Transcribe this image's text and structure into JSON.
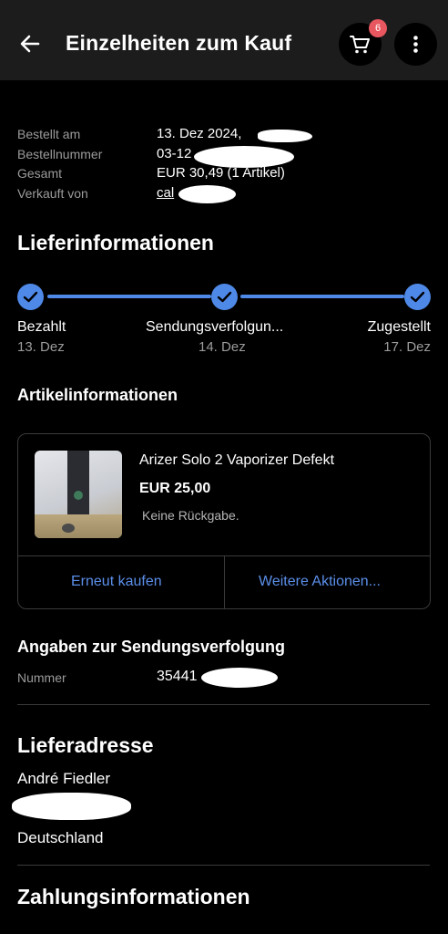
{
  "header": {
    "title": "Einzelheiten zum Kauf",
    "cart_count": "6"
  },
  "order": {
    "rows": [
      {
        "label": "Bestellt am",
        "value": "13. Dez 2024,"
      },
      {
        "label": "Bestellnummer",
        "value": "03-12"
      },
      {
        "label": "Gesamt",
        "value": "EUR 30,49 (1 Artikel)"
      },
      {
        "label": "Verkauft von",
        "value": "cal"
      }
    ]
  },
  "delivery": {
    "heading": "Lieferinformationen",
    "steps": [
      {
        "label": "Bezahlt",
        "date": "13. Dez"
      },
      {
        "label": "Sendungsverfolgun...",
        "date": "14. Dez"
      },
      {
        "label": "Zugestellt",
        "date": "17. Dez"
      }
    ],
    "progress": 1.0,
    "accent": "#4f89e8"
  },
  "item": {
    "heading": "Artikelinformationen",
    "title": "Arizer Solo 2 Vaporizer Defekt",
    "price": "EUR 25,00",
    "note": "Keine Rückgabe.",
    "actions": {
      "buy_again": "Erneut kaufen",
      "more": "Weitere Aktionen..."
    }
  },
  "tracking": {
    "heading": "Angaben zur Sendungsverfolgung",
    "label": "Nummer",
    "value": "35441"
  },
  "address": {
    "heading": "Lieferadresse",
    "name": "André Fiedler",
    "line3": "Deutschland"
  },
  "payment": {
    "heading": "Zahlungsinformationen"
  }
}
